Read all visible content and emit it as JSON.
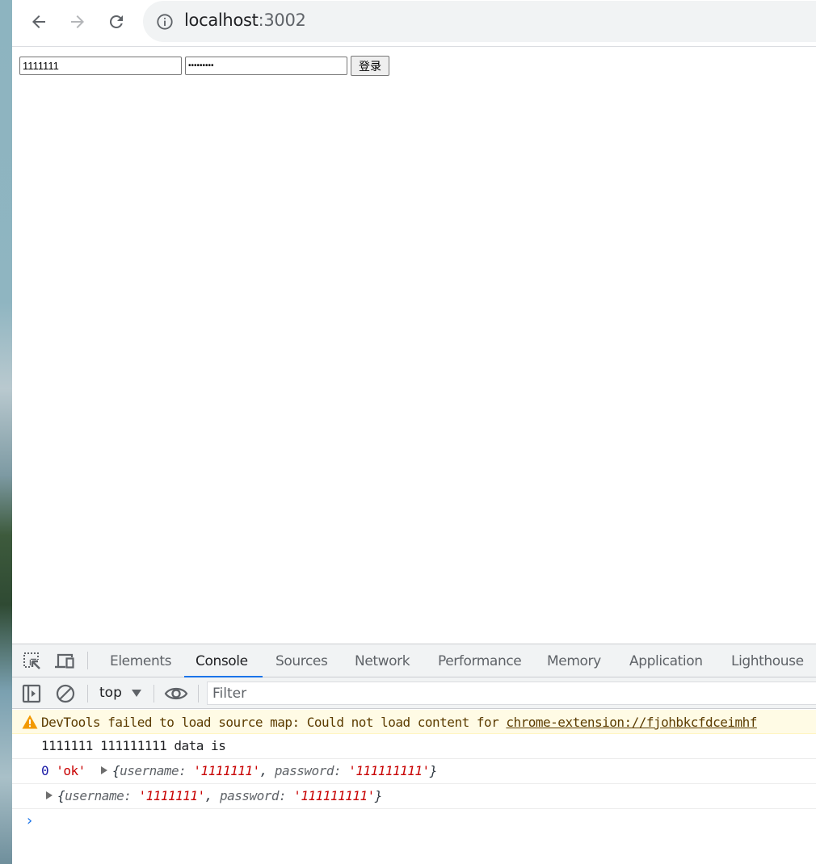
{
  "browser": {
    "url_host": "localhost",
    "url_port": ":3002",
    "icons": {
      "back": "arrow-left-icon",
      "forward": "arrow-right-icon",
      "reload": "reload-icon",
      "site_info": "info-icon"
    }
  },
  "page": {
    "username_value": "1111111",
    "password_value": "111111111",
    "login_label": "登录"
  },
  "devtools": {
    "tabs": [
      {
        "label": "Elements"
      },
      {
        "label": "Console",
        "active": true
      },
      {
        "label": "Sources"
      },
      {
        "label": "Network"
      },
      {
        "label": "Performance"
      },
      {
        "label": "Memory"
      },
      {
        "label": "Application"
      },
      {
        "label": "Lighthouse"
      }
    ],
    "context": "top",
    "filter_placeholder": "Filter",
    "console": {
      "warning": {
        "text": "DevTools failed to load source map: Could not load content for ",
        "link": "chrome-extension://fjohbkcfdceimhf"
      },
      "log1": "1111111 111111111 data is",
      "log2": {
        "num": "0",
        "str": "'ok'",
        "obj_open": "{",
        "k1": "username: ",
        "v1": "'1111111'",
        "sep": ", ",
        "k2": "password: ",
        "v2": "'111111111'",
        "obj_close": "}"
      },
      "log3": {
        "obj_open": "{",
        "k1": "username: ",
        "v1": "'1111111'",
        "sep": ", ",
        "k2": "password: ",
        "v2": "'111111111'",
        "obj_close": "}"
      },
      "prompt": "›"
    }
  },
  "colors": {
    "accent": "#1a73e8",
    "warning_bg": "#fffbe5",
    "string": "#c80000",
    "number": "#1a1aa6"
  }
}
